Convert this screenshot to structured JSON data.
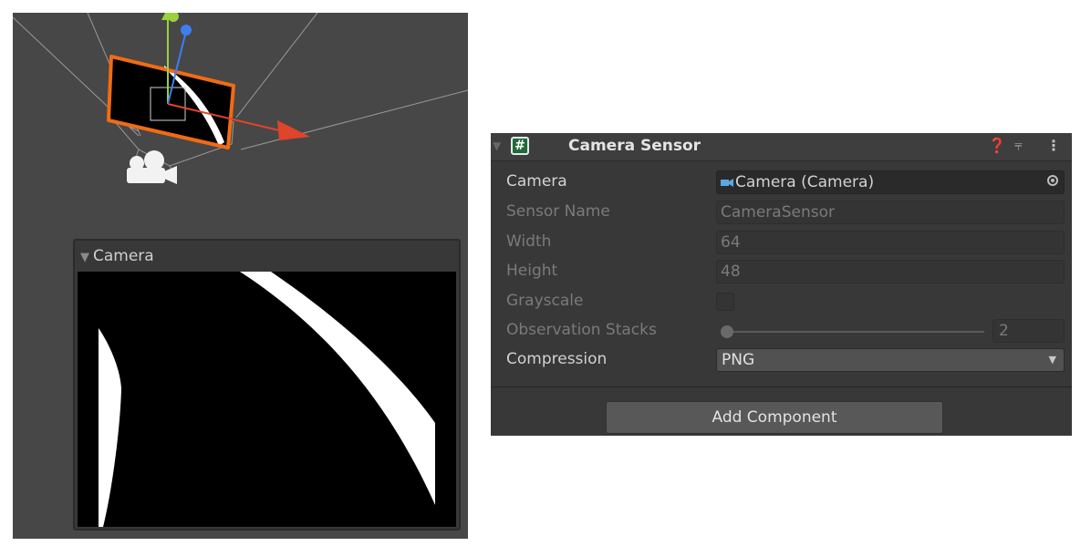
{
  "scene": {
    "preview": {
      "title": "Camera"
    }
  },
  "inspector": {
    "component": {
      "title": "Camera Sensor",
      "icons": [
        "script-icon",
        "help-icon",
        "presets-icon",
        "menu-icon"
      ]
    },
    "fields": [
      {
        "label": "Camera",
        "value": "Camera (Camera)",
        "enabled": true
      },
      {
        "label": "Sensor Name",
        "value": "CameraSensor",
        "enabled": false
      },
      {
        "label": "Width",
        "value": "64",
        "enabled": false
      },
      {
        "label": "Height",
        "value": "48",
        "enabled": false
      },
      {
        "label": "Grayscale",
        "checked": false,
        "enabled": false
      },
      {
        "label": "Observation Stacks",
        "value": "2",
        "slider_level": 0.0,
        "enabled": false
      },
      {
        "label": "Compression",
        "value": "PNG",
        "enabled": true
      }
    ],
    "add_component_label": "Add Component"
  },
  "colors": {
    "scene_bg": "#474747",
    "selection_outline": "#f26b12",
    "gizmo_x": "#e0442a",
    "gizmo_y": "#9ad13e",
    "gizmo_z": "#3e7ef0",
    "inspector_bg": "#383838",
    "camera_icon_accent": "#5aa9e6"
  }
}
